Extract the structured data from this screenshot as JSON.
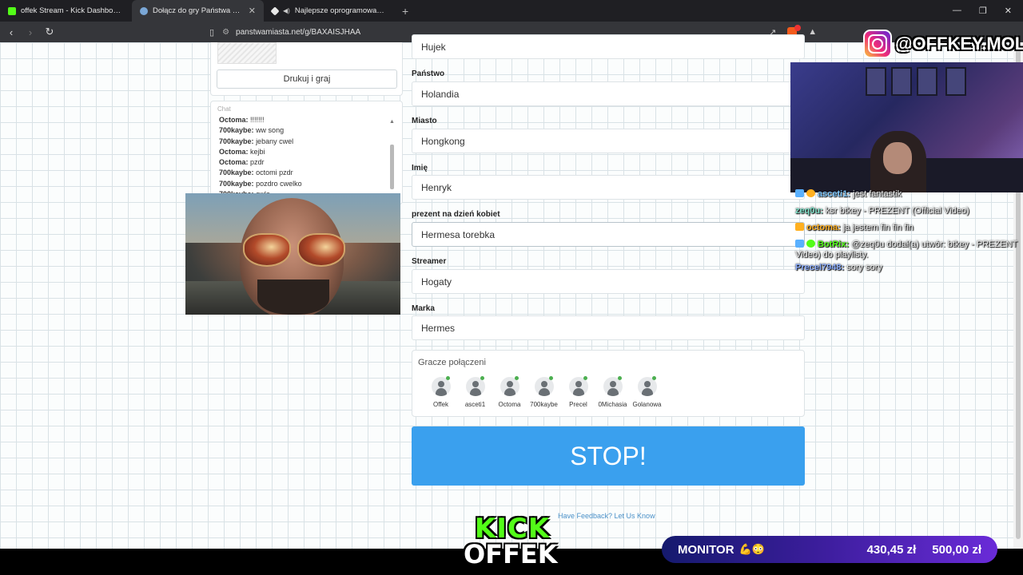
{
  "browser": {
    "tabs": [
      {
        "title": "offek Stream - Kick Dashboard",
        "color": "#53fc18",
        "active": false
      },
      {
        "title": "Dołącz do gry Państwa Miasta",
        "color": "#7aa7d6",
        "active": true
      },
      {
        "title": "Najlepsze oprogramowanie do u",
        "color": "#e8e8e8",
        "active": false
      }
    ],
    "url": "panstwamiasta.net/g/BAXAISJHAA"
  },
  "left_panel": {
    "print_button": "Drukuj i graj",
    "chat_heading": "Chat",
    "chat": [
      {
        "user": "Octoma:",
        "text": "!!!!!!!"
      },
      {
        "user": "700kaybe:",
        "text": "ww song"
      },
      {
        "user": "700kaybe:",
        "text": "jebany cwel"
      },
      {
        "user": "Octoma:",
        "text": "kejbi"
      },
      {
        "user": "Octoma:",
        "text": "pzdr"
      },
      {
        "user": "700kaybe:",
        "text": "octomi pzdr"
      },
      {
        "user": "700kaybe:",
        "text": "pozdro cwelko"
      },
      {
        "user": "700kaybe:",
        "text": "cwle"
      }
    ]
  },
  "form": {
    "fields": [
      {
        "label": "",
        "value": "Hujek"
      },
      {
        "label": "Państwo",
        "value": "Holandia"
      },
      {
        "label": "Miasto",
        "value": "Hongkong"
      },
      {
        "label": "Imię",
        "value": "Henryk"
      },
      {
        "label": "prezent na dzień kobiet",
        "value": "Hermesa torebka"
      },
      {
        "label": "Streamer",
        "value": "Hogaty"
      },
      {
        "label": "Marka",
        "value": "Hermes"
      }
    ],
    "players_title": "Gracze połączeni",
    "players": [
      "Offek",
      "asceti1",
      "Octoma",
      "700kaybe",
      "Precel",
      "0Michasia",
      "Golanowa"
    ],
    "stop_button": "STOP!",
    "feedback_link": "Have Feedback? Let Us Know"
  },
  "overlay": {
    "instagram_handle": "@OFFKEY.MOLLY",
    "stream_chat": [
      {
        "user": "asceti1:",
        "text": "jest fantastik",
        "color": "#7fc8ff"
      },
      {
        "user": "zeq0u:",
        "text": "ksr btkey - PREZENT (Official Video)",
        "color": "#7fe0c8"
      },
      {
        "user": "octoma:",
        "text": "ja jestem fin fin fin",
        "color": "#ffb020"
      },
      {
        "user": "BotRix:",
        "text": "@zeq0u dodał(a) utwór: btkey - PREZENT",
        "color": "#53fc18"
      },
      {
        "user": "",
        "text": "Video) do playlisty.",
        "color": "#ffffff"
      },
      {
        "user": "Precel7948:",
        "text": "sory sory",
        "color": "#8fb0ff"
      }
    ],
    "kick_line1": "KICK",
    "kick_line2": "OFFEK",
    "monitor_label": "MONITOR",
    "monitor_emoji": "💪😳",
    "monitor_amount": "430,45 zł",
    "monitor_goal": "500,00 zł"
  }
}
